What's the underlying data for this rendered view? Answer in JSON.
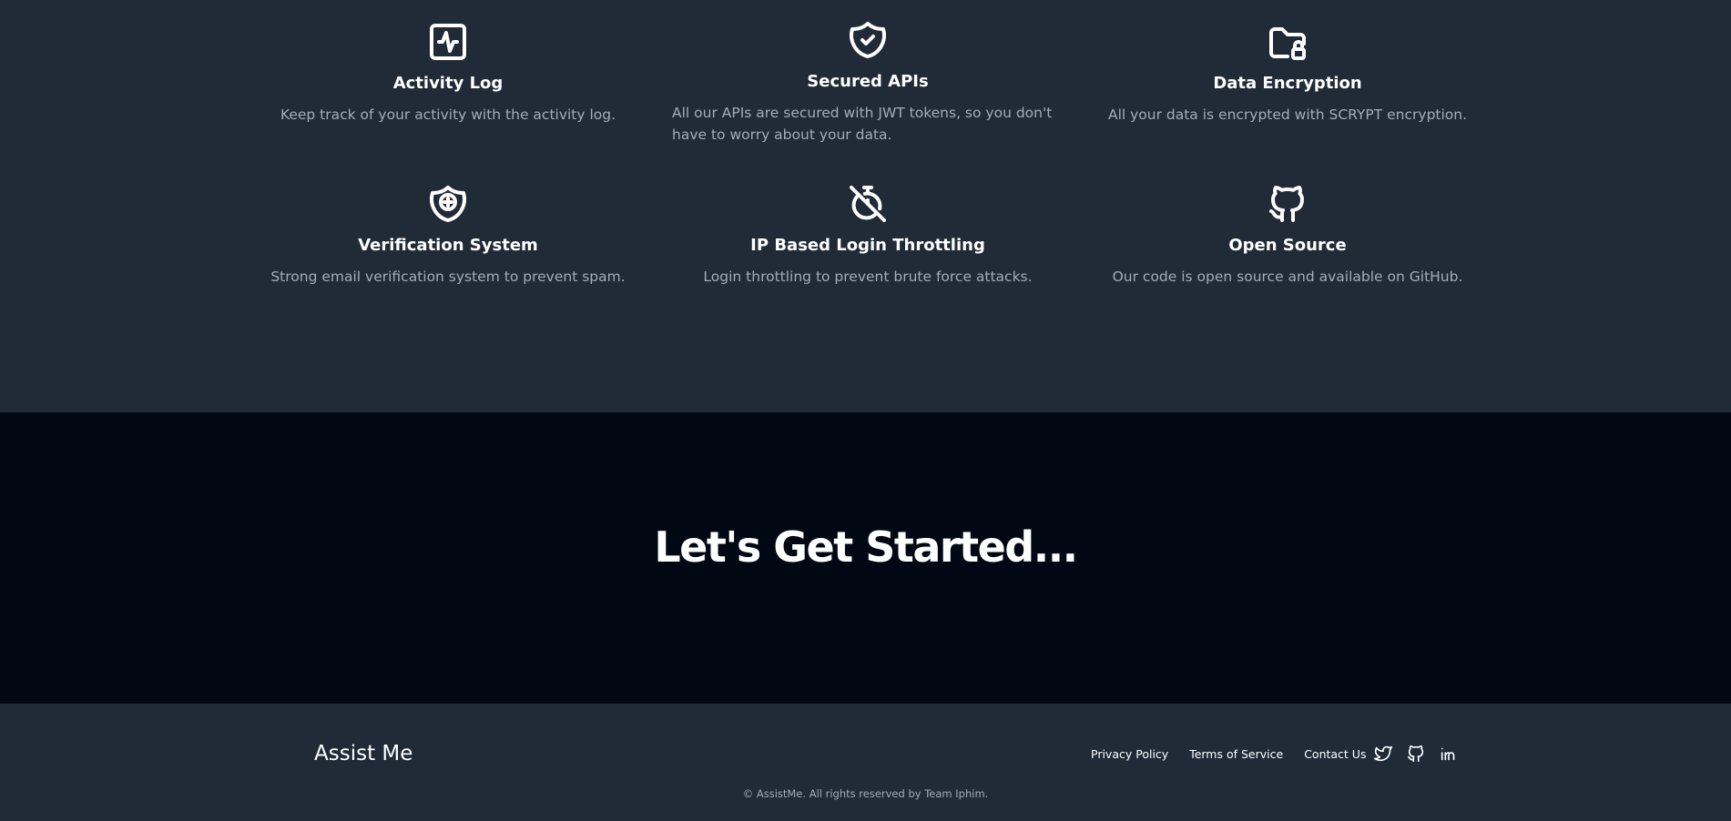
{
  "features": [
    {
      "icon": "activity-icon",
      "title": "Activity Log",
      "description": "Keep track of your activity with the activity log."
    },
    {
      "icon": "shield-check-icon",
      "title": "Secured APIs",
      "description": "All our APIs are secured with JWT tokens, so you don't have to worry about your data."
    },
    {
      "icon": "folder-lock-icon",
      "title": "Data Encryption",
      "description": "All your data is encrypted with SCRYPT encryption."
    },
    {
      "icon": "shield-plus-icon",
      "title": "Verification System",
      "description": "Strong email verification system to prevent spam."
    },
    {
      "icon": "timer-off-icon",
      "title": "IP Based Login Throttling",
      "description": "Login throttling to prevent brute force attacks."
    },
    {
      "icon": "github-icon",
      "title": "Open Source",
      "description": "Our code is open source and available on GitHub."
    }
  ],
  "cta": {
    "heading": "Let's Get Started..."
  },
  "footer": {
    "brand": "Assist Me",
    "links": [
      {
        "label": "Privacy Policy"
      },
      {
        "label": "Terms of Service"
      },
      {
        "label": "Contact Us"
      }
    ],
    "social": [
      "twitter-icon",
      "github-icon",
      "linkedin-icon"
    ],
    "copyright": "© AssistMe. All rights reserved by Team Iphim."
  },
  "colors": {
    "features_bg": "#212a37",
    "cta_bg": "#010814",
    "text_primary": "#ffffff",
    "text_muted": "#a3acb9"
  }
}
